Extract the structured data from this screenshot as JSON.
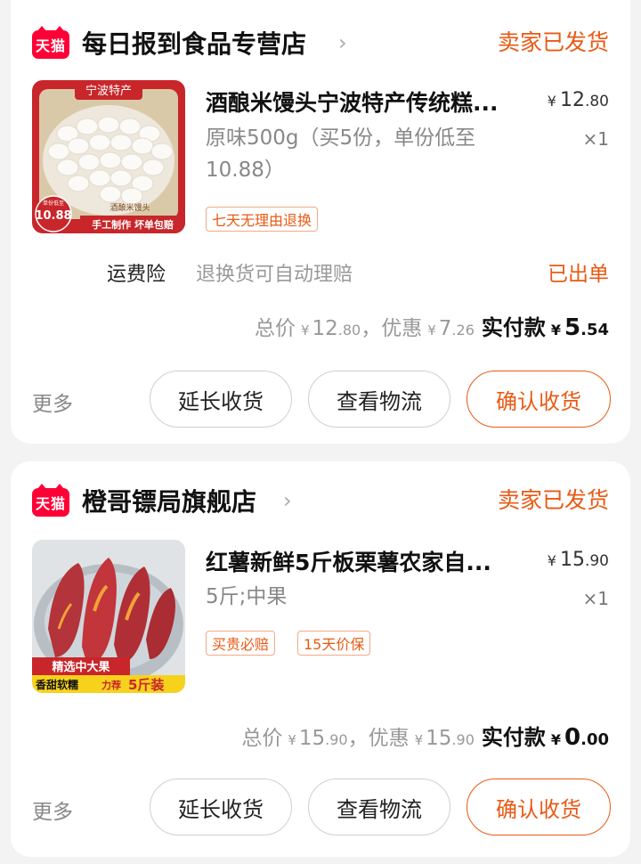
{
  "orders": [
    {
      "platform_badge": "天猫",
      "shop_name": "每日报到食品专营店",
      "chevron": "›",
      "status": "卖家已发货",
      "product": {
        "title": "酒酿米馒头宁波特产传统糕...",
        "spec": "原味500g（买5份，单份低至10.88）",
        "price_yen": "¥",
        "price_int": "12",
        "price_dec": ".80",
        "qty": "×1",
        "tags": [
          "七天无理由退换"
        ],
        "image": {
          "banner": "宁波特产",
          "price_badge_small": "单份低至",
          "price_badge": "10.88",
          "label": "酒酿米馒头",
          "bottom_strip": "手工制作 坏单包赔"
        }
      },
      "insurance": {
        "label": "运费险",
        "desc": "退换货可自动理赔",
        "status": "已出单"
      },
      "totals": {
        "total_label": "总价",
        "total_int": "12",
        "total_dec": ".80",
        "discount_label": "，优惠",
        "discount_int": "7",
        "discount_dec": ".26",
        "paid_label": "实付款",
        "paid_int": "5",
        "paid_dec": ".54"
      },
      "actions": {
        "more": "更多",
        "extend": "延长收货",
        "logistics": "查看物流",
        "confirm": "确认收货"
      }
    },
    {
      "platform_badge": "天猫",
      "shop_name": "橙哥镖局旗舰店",
      "chevron": "›",
      "status": "卖家已发货",
      "product": {
        "title": "红薯新鲜5斤板栗薯农家自...",
        "spec": "5斤;中果",
        "price_yen": "¥",
        "price_int": "15",
        "price_dec": ".90",
        "qty": "×1",
        "tags": [
          "买贵必赔",
          "15天价保"
        ],
        "image": {
          "line1": "精选中大果",
          "line2a": "香甜软糯",
          "line2b": "力荐",
          "line2c": "5斤装"
        }
      },
      "totals": {
        "total_label": "总价",
        "total_int": "15",
        "total_dec": ".90",
        "discount_label": "，优惠",
        "discount_int": "15",
        "discount_dec": ".90",
        "paid_label": "实付款",
        "paid_int": "0",
        "paid_dec": ".00"
      },
      "actions": {
        "more": "更多",
        "extend": "延长收货",
        "logistics": "查看物流",
        "confirm": "确认收货"
      }
    }
  ],
  "colors": {
    "accent": "#e85a14",
    "tmall_red": "#ff0036",
    "background": "#f3f3f3"
  }
}
